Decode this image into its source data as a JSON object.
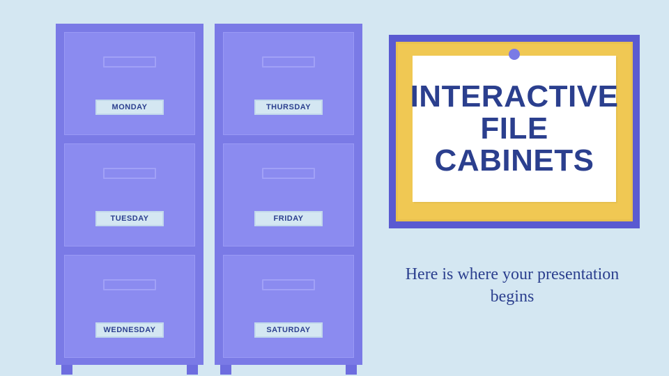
{
  "colors": {
    "background": "#d4e7f2",
    "cabinet_body": "#7a7ae6",
    "drawer_face": "#8b8bf0",
    "board_frame": "#5a5ad1",
    "board_cork": "#f0c853",
    "text_primary": "#2b3f8e"
  },
  "cabinets": [
    {
      "drawers": [
        "MONDAY",
        "TUESDAY",
        "WEDNESDAY"
      ]
    },
    {
      "drawers": [
        "THURSDAY",
        "FRIDAY",
        "SATURDAY"
      ]
    }
  ],
  "board": {
    "title_line1": "Interactive",
    "title_line2": "File Cabinets"
  },
  "subtitle": "Here is where your presentation begins"
}
